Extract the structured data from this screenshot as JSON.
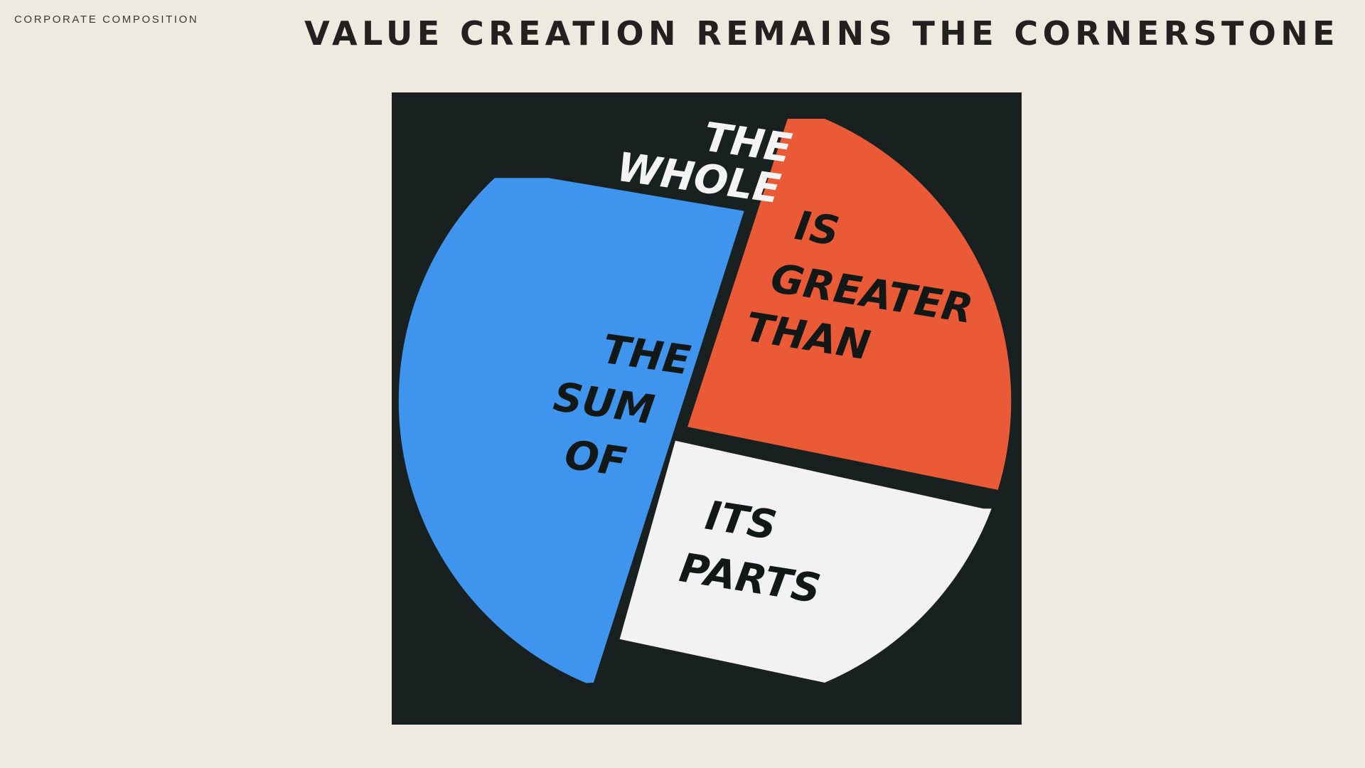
{
  "header": {
    "kicker": "CORPORATE COMPOSITION",
    "title": "VALUE CREATION REMAINS THE CORNERSTONE"
  },
  "image": {
    "colors": {
      "background": "#18211f",
      "blue": "#3f95ee",
      "orange": "#ea5a36",
      "white": "#f2f2f4",
      "ink": "#121816"
    },
    "text": {
      "line1": "THE",
      "line2": "WHOLE",
      "orange1": "IS",
      "orange2": "GREATER",
      "orange3": "THAN",
      "blue1": "THE",
      "blue2": "SUM",
      "blue3": "OF",
      "white1": "ITS",
      "white2": "PARTS"
    }
  }
}
